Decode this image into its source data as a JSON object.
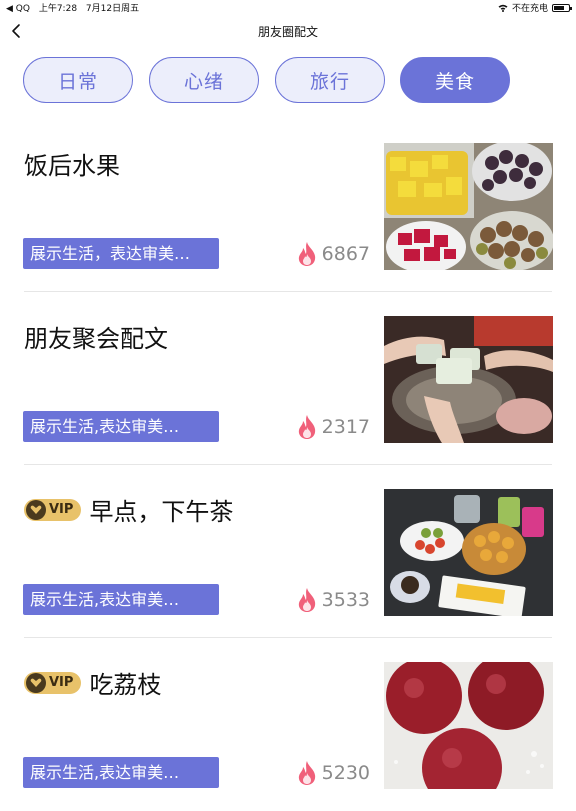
{
  "status": {
    "left": [
      "◀ QQ",
      "上午7:28",
      "7月12日周五"
    ],
    "right": "不在充电",
    "battery_level": 0.7
  },
  "nav": {
    "title": "朋友圈配文"
  },
  "tabs": [
    {
      "label": "日常",
      "active": false
    },
    {
      "label": "心绪",
      "active": false
    },
    {
      "label": "旅行",
      "active": false
    },
    {
      "label": "美食",
      "active": true
    }
  ],
  "items": [
    {
      "title": "饭后水果",
      "vip": false,
      "tag": "展示生活，表达审美…",
      "count": "6867",
      "image": "fruit-plates"
    },
    {
      "title": "朋友聚会配文",
      "vip": false,
      "tag": "展示生活,表达审美…",
      "count": "2317",
      "image": "cheers-hotpot"
    },
    {
      "title": "早点，下午茶",
      "vip": true,
      "vip_label": "VIP",
      "tag": "展示生活,表达审美…",
      "count": "3533",
      "image": "afternoon-tea"
    },
    {
      "title": "吃荔枝",
      "vip": true,
      "vip_label": "VIP",
      "tag": "展示生活,表达审美…",
      "count": "5230",
      "image": "lychees"
    }
  ],
  "colors": {
    "accent": "#6b73d8",
    "tab_bg": "#eceefb",
    "flame": "#f0607a",
    "vip_gold": "#e8c26a"
  }
}
